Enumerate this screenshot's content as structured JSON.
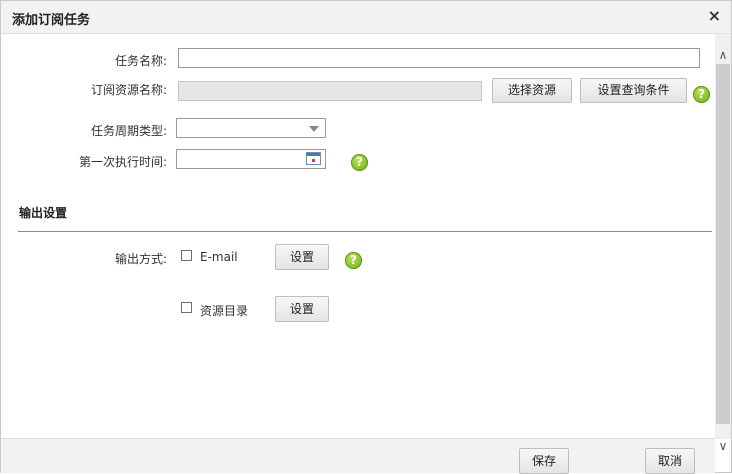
{
  "dialog": {
    "title": "添加订阅任务",
    "close_label": "×"
  },
  "form": {
    "task_name_label": "任务名称:",
    "task_name_value": "",
    "resource_name_label": "订阅资源名称:",
    "resource_name_value": "",
    "select_resource_button": "选择资源",
    "set_query_button": "设置查询条件",
    "period_type_label": "任务周期类型:",
    "period_type_value": "",
    "first_exec_label": "第一次执行时间:",
    "first_exec_value": ""
  },
  "output": {
    "section_title": "输出设置",
    "method_label": "输出方式:",
    "email_label": "E-mail",
    "email_settings_button": "设置",
    "dir_label": "资源目录",
    "dir_settings_button": "设置"
  },
  "footer": {
    "save_button": "保存",
    "cancel_button": "取消"
  },
  "icons": {
    "help": "?",
    "scroll_up": "∧",
    "scroll_down": "∨"
  },
  "colors": {
    "help_icon": "#7ab51d",
    "header_bg": "#f2f2f2",
    "divider": "#8c8c8c"
  }
}
